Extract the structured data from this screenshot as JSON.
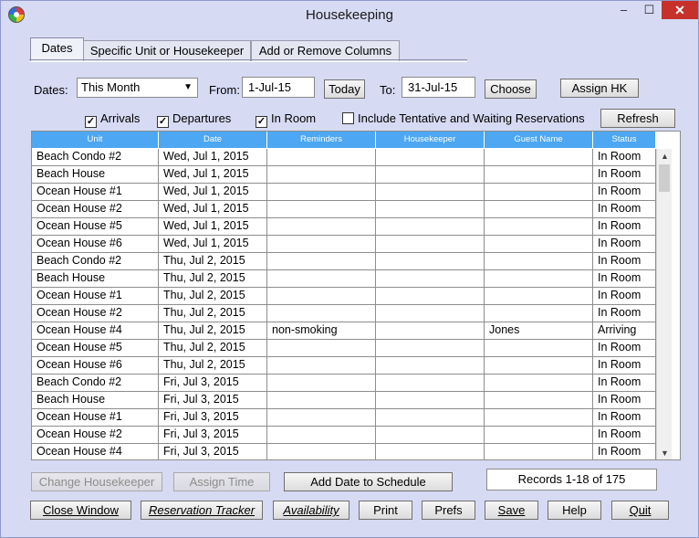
{
  "window": {
    "title": "Housekeeping",
    "min": "–",
    "max": "☐",
    "close": "✕"
  },
  "tabs": [
    "Dates",
    "Specific Unit or Housekeeper",
    "Add or Remove Columns"
  ],
  "filters": {
    "dates_label": "Dates:",
    "dates_value": "This Month",
    "from_label": "From:",
    "from_value": "1-Jul-15",
    "today_button": "Today",
    "to_label": "To:",
    "to_value": "31-Jul-15",
    "choose_button": "Choose",
    "assign_hk_button": "Assign HK",
    "refresh_button": "Refresh"
  },
  "checks": [
    {
      "label": "Arrivals",
      "checked": true
    },
    {
      "label": "Departures",
      "checked": true
    },
    {
      "label": "In Room",
      "checked": true
    },
    {
      "label": "Include Tentative and Waiting Reservations",
      "checked": false
    }
  ],
  "table": {
    "columns": [
      "Unit",
      "Date",
      "Reminders",
      "Housekeeper",
      "Guest Name",
      "Status"
    ],
    "rows": [
      [
        "Beach Condo #2",
        "Wed, Jul 1, 2015",
        "",
        "",
        "",
        "In Room"
      ],
      [
        "Beach House",
        "Wed, Jul 1, 2015",
        "",
        "",
        "",
        "In Room"
      ],
      [
        "Ocean House #1",
        "Wed, Jul 1, 2015",
        "",
        "",
        "",
        "In Room"
      ],
      [
        "Ocean House #2",
        "Wed, Jul 1, 2015",
        "",
        "",
        "",
        "In Room"
      ],
      [
        "Ocean House #5",
        "Wed, Jul 1, 2015",
        "",
        "",
        "",
        "In Room"
      ],
      [
        "Ocean House #6",
        "Wed, Jul 1, 2015",
        "",
        "",
        "",
        "In Room"
      ],
      [
        "Beach Condo #2",
        "Thu, Jul 2, 2015",
        "",
        "",
        "",
        "In Room"
      ],
      [
        "Beach House",
        "Thu, Jul 2, 2015",
        "",
        "",
        "",
        "In Room"
      ],
      [
        "Ocean House #1",
        "Thu, Jul 2, 2015",
        "",
        "",
        "",
        "In Room"
      ],
      [
        "Ocean House #2",
        "Thu, Jul 2, 2015",
        "",
        "",
        "",
        "In Room"
      ],
      [
        "Ocean House #4",
        "Thu, Jul 2, 2015",
        "non-smoking",
        "",
        "Jones",
        "Arriving"
      ],
      [
        "Ocean House #5",
        "Thu, Jul 2, 2015",
        "",
        "",
        "",
        "In Room"
      ],
      [
        "Ocean House #6",
        "Thu, Jul 2, 2015",
        "",
        "",
        "",
        "In Room"
      ],
      [
        "Beach Condo #2",
        "Fri, Jul 3, 2015",
        "",
        "",
        "",
        "In Room"
      ],
      [
        "Beach House",
        "Fri, Jul 3, 2015",
        "",
        "",
        "",
        "In Room"
      ],
      [
        "Ocean House #1",
        "Fri, Jul 3, 2015",
        "",
        "",
        "",
        "In Room"
      ],
      [
        "Ocean House #2",
        "Fri, Jul 3, 2015",
        "",
        "",
        "",
        "In Room"
      ],
      [
        "Ocean House #4",
        "Fri, Jul 3, 2015",
        "",
        "",
        "",
        "In Room"
      ]
    ]
  },
  "actions": {
    "change_housekeeper": "Change Housekeeper",
    "assign_time": "Assign Time",
    "add_date": "Add Date to Schedule",
    "records": "Records 1-18 of 175"
  },
  "footer": [
    "Close Window",
    "Reservation Tracker",
    "Availability",
    "Print",
    "Prefs",
    "Save",
    "Help",
    "Quit"
  ]
}
